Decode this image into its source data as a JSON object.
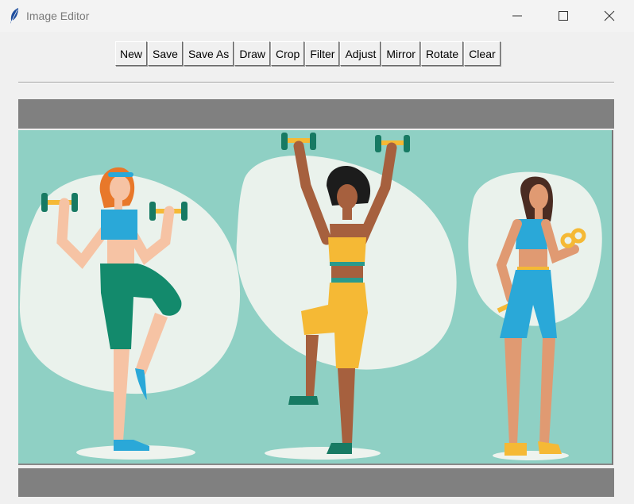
{
  "window": {
    "title": "Image Editor",
    "icon": "feather-icon",
    "controls": [
      "minimize-icon",
      "maximize-icon",
      "close-icon"
    ]
  },
  "toolbar": {
    "buttons": [
      {
        "id": "new",
        "label": "New"
      },
      {
        "id": "save",
        "label": "Save"
      },
      {
        "id": "save-as",
        "label": "Save As"
      },
      {
        "id": "draw",
        "label": "Draw"
      },
      {
        "id": "crop",
        "label": "Crop"
      },
      {
        "id": "filter",
        "label": "Filter"
      },
      {
        "id": "adjust",
        "label": "Adjust"
      },
      {
        "id": "mirror",
        "label": "Mirror"
      },
      {
        "id": "rotate",
        "label": "Rotate"
      },
      {
        "id": "clear",
        "label": "Clear"
      }
    ]
  },
  "canvas": {
    "image": "illustration of three women exercising with dumbbells",
    "colors": {
      "background": "#8fd0c4",
      "blob": "#eaf2ec",
      "band": "#808080"
    }
  }
}
